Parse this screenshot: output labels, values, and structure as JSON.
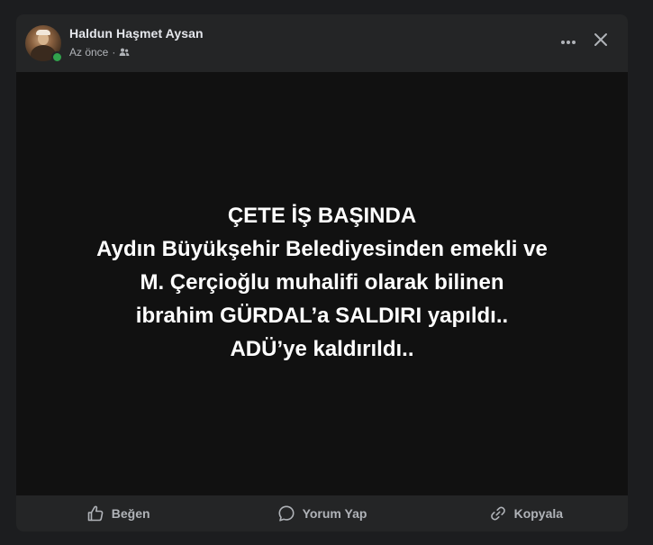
{
  "post": {
    "author": "Haldun Haşmet Aysan",
    "timestamp": "Az önce",
    "separator": "·",
    "audience_icon": "friends-icon",
    "body_lines": [
      "ÇETE İŞ BAŞINDA",
      "Aydın Büyükşehir Belediyesinden emekli ve",
      "M. Çerçioğlu muhalifi olarak bilinen",
      "ibrahim GÜRDAL’a SALDIRI yapıldı..",
      "ADÜ’ye kaldırıldı.."
    ],
    "background_color": "#111111"
  },
  "header": {
    "more_icon": "more-horizontal-icon",
    "close_icon": "close-icon"
  },
  "actions": {
    "like_label": "Beğen",
    "comment_label": "Yorum Yap",
    "copy_label": "Kopyala"
  },
  "colors": {
    "card": "#242526",
    "page": "#1c1d1f",
    "text_primary": "#e4e6eb",
    "text_secondary": "#b0b3b8",
    "online": "#31a24c"
  }
}
